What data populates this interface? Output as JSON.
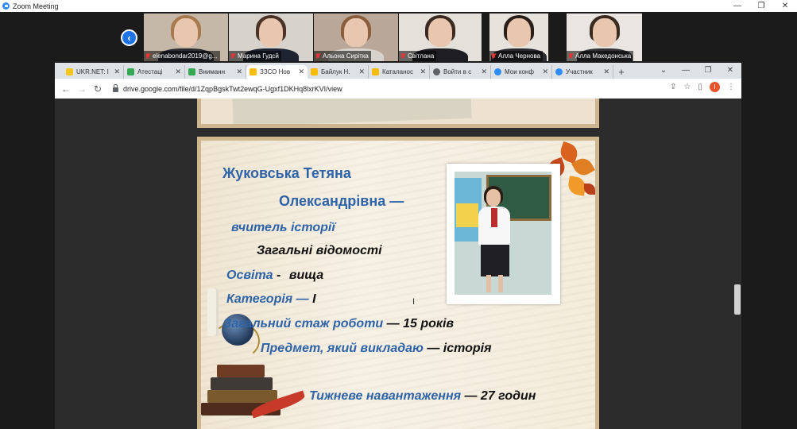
{
  "zoom": {
    "title": "Zoom Meeting",
    "participants": [
      {
        "name": "elenabondar2019@g..."
      },
      {
        "name": "Марина Гудсй"
      },
      {
        "name": "Альона Сиріткa"
      },
      {
        "name": "Світлана"
      },
      {
        "name": "Алла Чернова"
      },
      {
        "name": "Алла Македонська"
      }
    ]
  },
  "browser": {
    "tabs": [
      {
        "label": "UKR.NET: I",
        "color": "#f5c518"
      },
      {
        "label": "Атестаці",
        "color": "#34a853"
      },
      {
        "label": "Вниманн",
        "color": "#34a853"
      },
      {
        "label": "ЗЗСО Нов",
        "color": "#fbbc04",
        "active": true
      },
      {
        "label": "Байлук Н.",
        "color": "#fbbc04"
      },
      {
        "label": "Каталанос",
        "color": "#fbbc04"
      },
      {
        "label": "Войти в с",
        "color": "#5f6368"
      },
      {
        "label": "Мои конф",
        "color": "#2d8cff"
      },
      {
        "label": "Участник",
        "color": "#2d8cff"
      }
    ],
    "new_tab": "+",
    "url": "drive.google.com/file/d/1ZqpBgskTwt2ewqG-Ugxf1DKHq8lxrKVI/view",
    "profile_initial": "I"
  },
  "slide": {
    "name_line1": "Жуковська Тетяна",
    "name_line2": "Олександрівна —",
    "role": "вчитель історії",
    "section": "Загальні відомості",
    "education_label": "Освіта",
    "education_sep": "-",
    "education_value": "вища",
    "category_label": "Категорія",
    "category_sep": "—",
    "category_value": "I",
    "experience_label": "Загальний стаж роботи",
    "experience_value": "— 15 років",
    "subject_label": "Предмет, який викладаю",
    "subject_value": "— історія",
    "workload_label": "Тижневе навантаження",
    "workload_value": "— 27 годин"
  },
  "colors": {
    "label_blue": "#2e63a8",
    "value_black": "#111111",
    "zoom_accent": "#1f73e8"
  }
}
